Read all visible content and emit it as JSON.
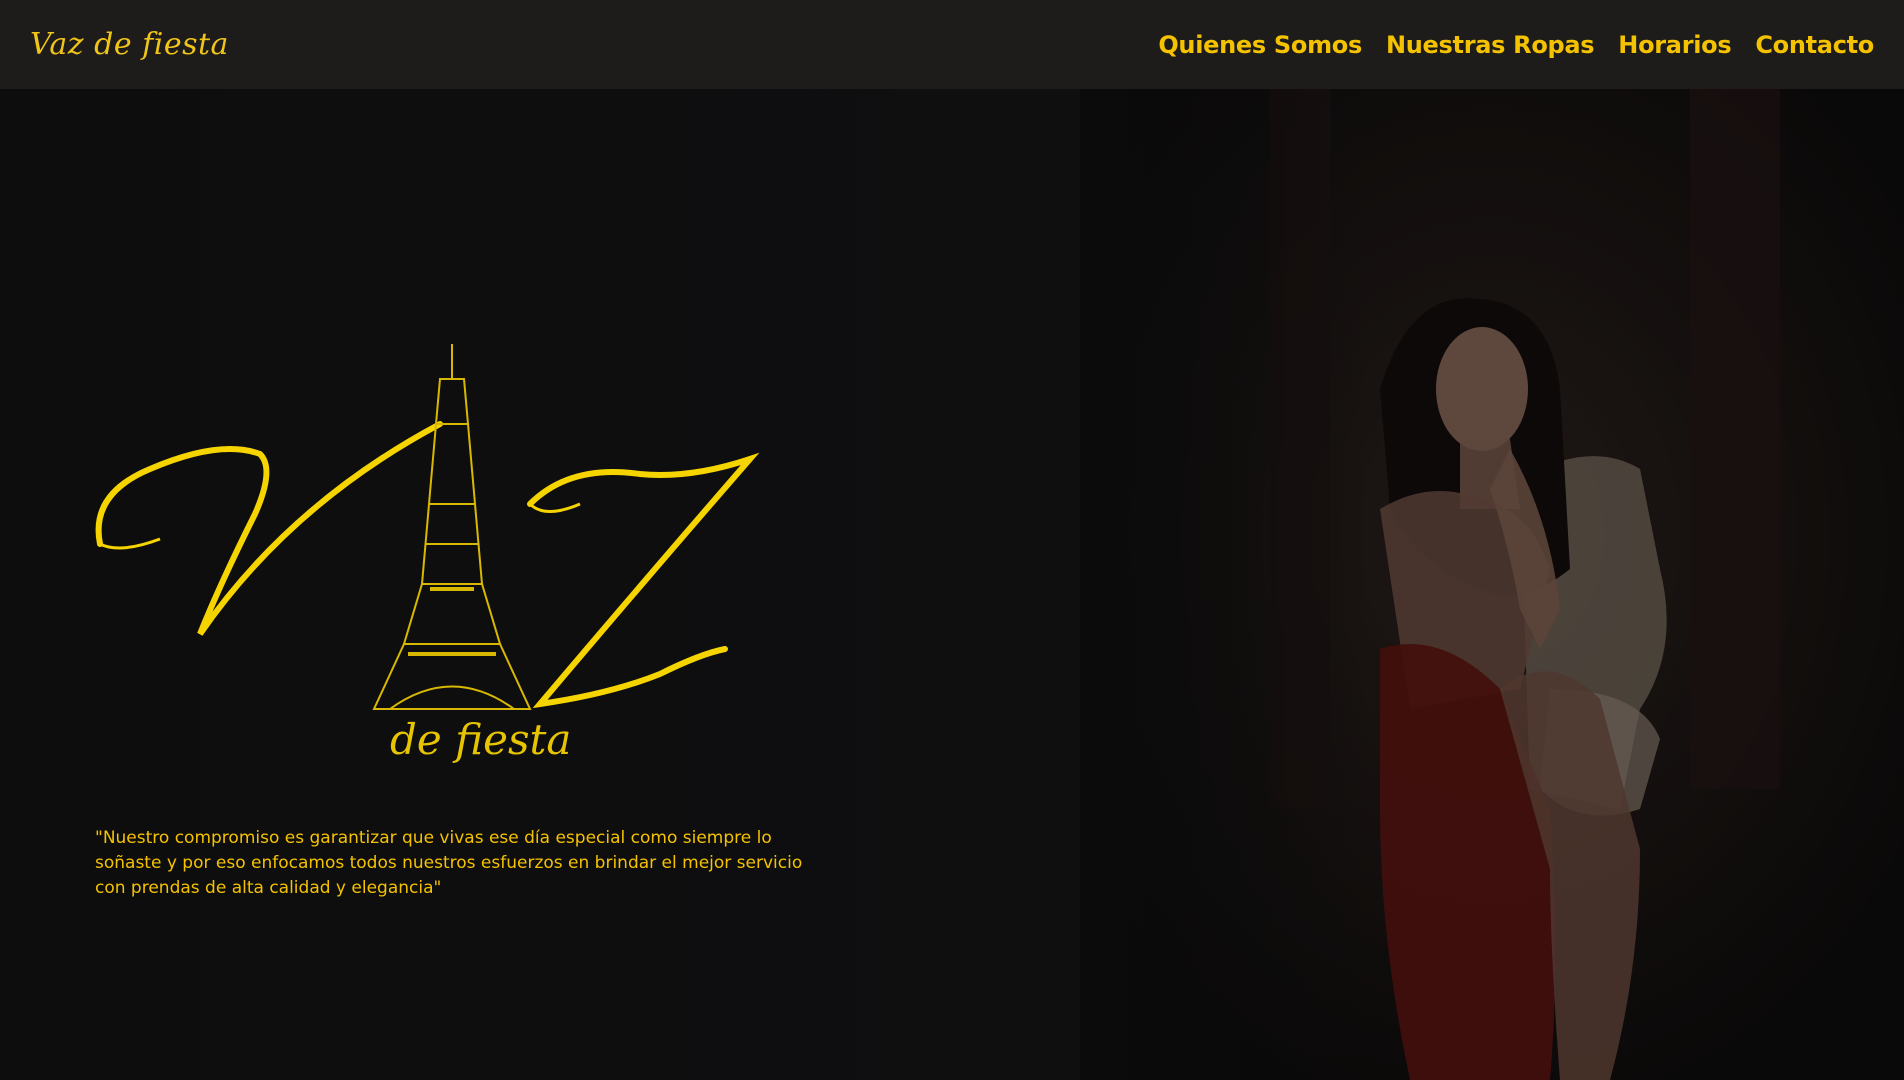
{
  "header": {
    "brand": "Vaz de fiesta",
    "nav": [
      {
        "label": "Quienes Somos"
      },
      {
        "label": "Nuestras Ropas"
      },
      {
        "label": "Horarios"
      },
      {
        "label": "Contacto"
      }
    ]
  },
  "hero": {
    "logo_text": "VAZ de fiesta",
    "quote": "\"Nuestro compromiso es garantizar que vivas ese día especial como siempre lo soñaste y por eso enfocamos todos nuestros esfuerzos en brindar el mejor servicio con prendas de alta calidad y elegancia\""
  },
  "colors": {
    "accent": "#f5c200",
    "header_bg": "#1d1c1b",
    "page_bg": "#0e0e0f"
  }
}
